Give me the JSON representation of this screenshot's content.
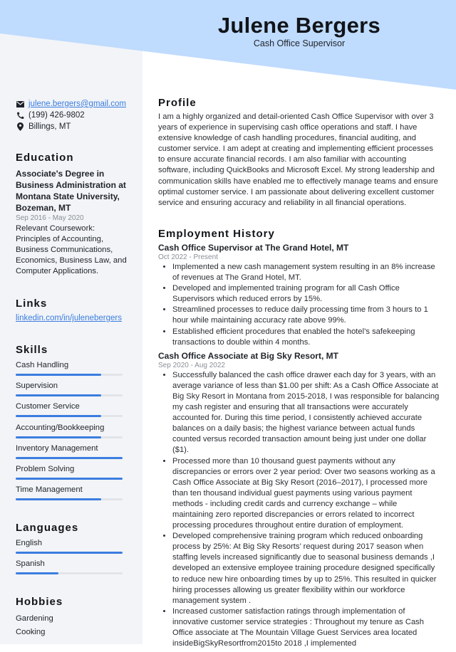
{
  "header": {
    "name": "Julene Bergers",
    "title": "Cash Office Supervisor"
  },
  "colors": {
    "header_band": "#bfdbfe",
    "sidebar_bg": "#f2f4f7",
    "accent": "#3b7de0"
  },
  "contact": {
    "email": "julene.bergers@gmail.com",
    "phone": "(199) 426-9802",
    "location": "Billings, MT",
    "icons": [
      "envelope-icon",
      "phone-icon",
      "map-pin-icon"
    ]
  },
  "education": {
    "heading": "Education",
    "degree": "Associate's Degree in Business Administration at Montana State University, Bozeman, MT",
    "dates": "Sep 2016 - May 2020",
    "description": "Relevant Coursework: Principles of Accounting, Business Communications, Economics, Business Law, and Computer Applications."
  },
  "links": {
    "heading": "Links",
    "items": [
      "linkedin.com/in/julenebergers"
    ]
  },
  "skills": {
    "heading": "Skills",
    "items": [
      {
        "label": "Cash Handling",
        "level": 0.8
      },
      {
        "label": "Supervision",
        "level": 0.8
      },
      {
        "label": "Customer Service",
        "level": 0.8
      },
      {
        "label": "Accounting/Bookkeeping",
        "level": 0.8
      },
      {
        "label": "Inventory Management",
        "level": 1.0
      },
      {
        "label": "Problem Solving",
        "level": 1.0
      },
      {
        "label": "Time Management",
        "level": 0.8
      }
    ]
  },
  "languages": {
    "heading": "Languages",
    "items": [
      {
        "label": "English",
        "level": 1.0
      },
      {
        "label": "Spanish",
        "level": 0.4
      }
    ]
  },
  "hobbies": {
    "heading": "Hobbies",
    "items": [
      "Gardening",
      "Cooking"
    ]
  },
  "profile": {
    "heading": "Profile",
    "text": "I am a highly organized and detail-oriented Cash Office Supervisor with over 3 years of experience in supervising cash office operations and staff. I have extensive knowledge of cash handling procedures, financial auditing, and customer service. I am adept at creating and implementing efficient processes to ensure accurate financial records. I am also familiar with accounting software, including QuickBooks and Microsoft Excel. My strong leadership and communication skills have enabled me to effectively manage teams and ensure optimal customer service. I am passionate about delivering excellent customer service and ensuring accuracy and reliability in all financial operations."
  },
  "employment": {
    "heading": "Employment History",
    "jobs": [
      {
        "title": "Cash Office Supervisor at The Grand Hotel, MT",
        "dates": "Oct 2022 - Present",
        "bullets": [
          "Implemented a new cash management system resulting in an 8% increase of revenues at The Grand Hotel, MT.",
          "Developed and implemented training program for all Cash Office Supervisors which reduced errors by 15%.",
          "Streamlined processes to reduce daily processing time from 3 hours to 1 hour while maintaining accuracy rate above 99%.",
          "Established efficient procedures that enabled the hotel’s safekeeping transactions to double within 4 months."
        ]
      },
      {
        "title": "Cash Office Associate at Big Sky Resort, MT",
        "dates": "Sep 2020 - Aug 2022",
        "bullets": [
          "Successfully balanced the cash office drawer each day for 3 years, with an average variance of less than $1.00 per shift: As a Cash Office Associate at Big Sky Resort in Montana from 2015-2018, I was responsible for balancing my cash register and ensuring that all transactions were accurately accounted for. During this time period, I consistently achieved accurate balances on a daily basis; the highest variance between actual funds counted versus recorded transaction amount being just under one dollar ($1).",
          "Processed more than 10 thousand guest payments without any discrepancies or errors over 2 year period: Over two seasons working as a Cash Office Associate at Big Sky Resort (2016–2017), I processed more than ten thousand individual guest payments using various payment methods - including credit cards and currency exchange – while maintaining zero reported discrepancies or errors related to incorrect processing procedures throughout entire duration of employment.",
          "Developed comprehensive training program which reduced onboarding process by 25%: At Big Sky Resorts’ request during 2017 season when staffing levels increased significantly due to seasonal business demands ,I developed an extensive employee training procedure designed specifically to reduce new hire onboarding times by up to 25%. This resulted in quicker hiring processes allowing us greater flexibility within our workforce management system .",
          "Increased customer satisfaction ratings through implementation of innovative customer service strategies : Throughout my tenure as Cash Office associate at The Mountain Village Guest Services area located insideBigSkyResortfrom2015to 2018 ,I implemented"
        ]
      }
    ]
  }
}
